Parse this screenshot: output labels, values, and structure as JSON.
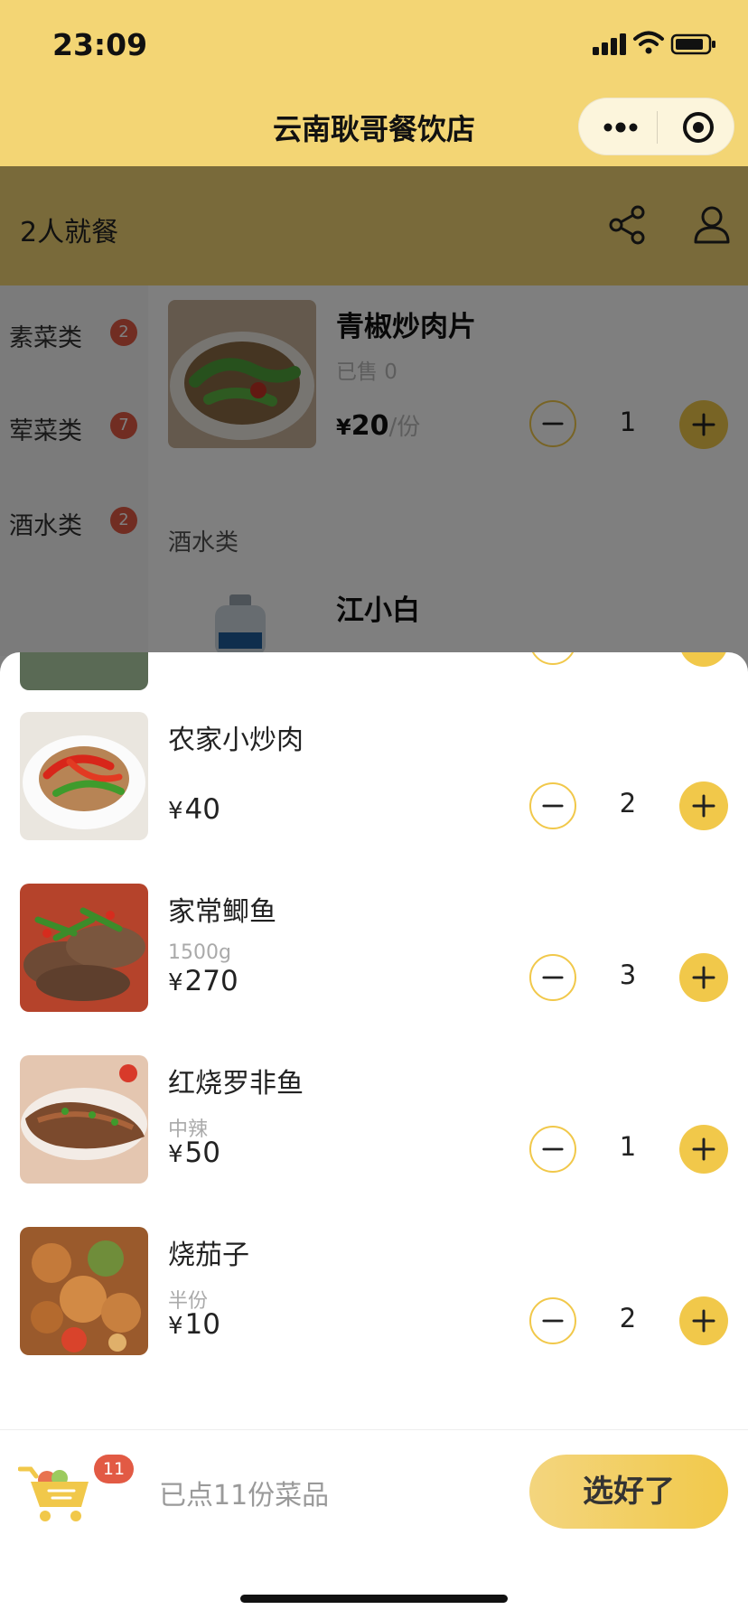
{
  "status": {
    "time": "23:09"
  },
  "nav": {
    "title": "云南耿哥餐饮店"
  },
  "info": {
    "diners": "2人就餐"
  },
  "categories": [
    {
      "label": "素菜类",
      "badge": "2"
    },
    {
      "label": "荤菜类",
      "badge": "7"
    },
    {
      "label": "酒水类",
      "badge": "2"
    }
  ],
  "bg_menu": {
    "dish": {
      "name": "青椒炒肉片",
      "sold": "已售 0",
      "currency": "¥",
      "price": "20",
      "unit": "/份",
      "qty": "1"
    },
    "section": "酒水类",
    "dish2": {
      "name": "江小白"
    }
  },
  "cart_items": [
    {
      "name": "农家小炒肉",
      "spec": "",
      "currency": "¥",
      "price": "40",
      "qty": "2"
    },
    {
      "name": "家常鲫鱼",
      "spec": "1500g",
      "currency": "¥",
      "price": "270",
      "qty": "3"
    },
    {
      "name": "红烧罗非鱼",
      "spec": "中辣",
      "currency": "¥",
      "price": "50",
      "qty": "1"
    },
    {
      "name": "烧茄子",
      "spec": "半份",
      "currency": "¥",
      "price": "10",
      "qty": "2"
    }
  ],
  "footer": {
    "cart_count": "11",
    "summary": "已点11份菜品",
    "checkout_label": "选好了"
  },
  "colors": {
    "accent": "#f1c84a",
    "nav_bg": "#f3d574",
    "badge": "#e25a44"
  },
  "icons": [
    "signal-icon",
    "wifi-icon",
    "battery-icon",
    "more-icon",
    "target-icon",
    "share-icon",
    "user-icon",
    "minus-icon",
    "plus-icon",
    "cart-icon"
  ]
}
